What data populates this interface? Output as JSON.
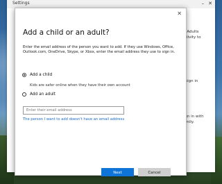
{
  "settings_window": {
    "title": "Settings",
    "minimize": "–",
    "close": "✕",
    "partial_text_lines": [
      "C. Adults",
      "activity to",
      "n sign in",
      "sign in with",
      "family."
    ]
  },
  "dialog": {
    "close_glyph": "✕",
    "title": "Add a child or an adult?",
    "description": "Enter the email address of the person you want to add. If they use Windows, Office, Outlook.com, OneDrive, Skype, or Xbox, enter the email address they use to sign in.",
    "options": [
      {
        "label": "Add a child",
        "checked": true
      },
      {
        "label": "Add an adult",
        "checked": false
      }
    ],
    "child_hint": "Kids are safer online when they have their own account",
    "email_input": {
      "placeholder": "Enter their email address",
      "value": ""
    },
    "no_email_link": "The person I want to add doesn't have an email address",
    "next_label": "Next",
    "cancel_label": "Cancel"
  },
  "colors": {
    "accent": "#0f74d8",
    "link": "#1a69c4",
    "cancel_bg": "#cfcfcf"
  }
}
